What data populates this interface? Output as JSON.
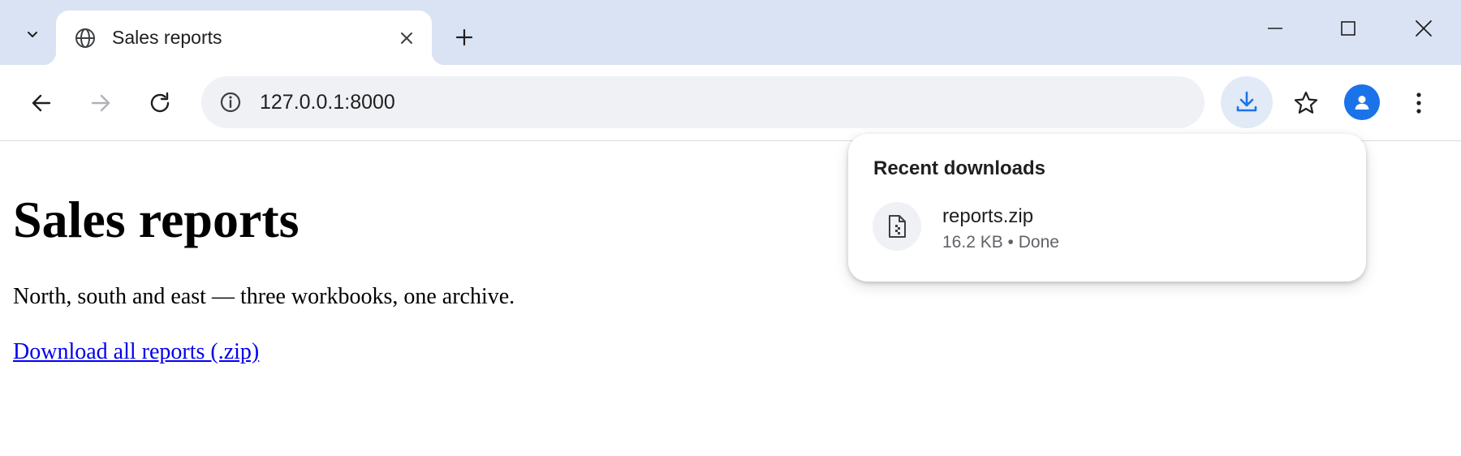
{
  "tab": {
    "title": "Sales reports"
  },
  "address_bar": {
    "url": "127.0.0.1:8000"
  },
  "page": {
    "heading": "Sales reports",
    "description": "North, south and east — three workbooks, one archive.",
    "download_link": "Download all reports (.zip)"
  },
  "downloads": {
    "title": "Recent downloads",
    "items": [
      {
        "name": "reports.zip",
        "status": "16.2 KB • Done",
        "icon": "zip-file-icon"
      }
    ]
  },
  "colors": {
    "tabstrip": "#dae3f4",
    "accent": "#1a73e8",
    "link": "#0000ee",
    "omnibox": "#eff1f5"
  }
}
